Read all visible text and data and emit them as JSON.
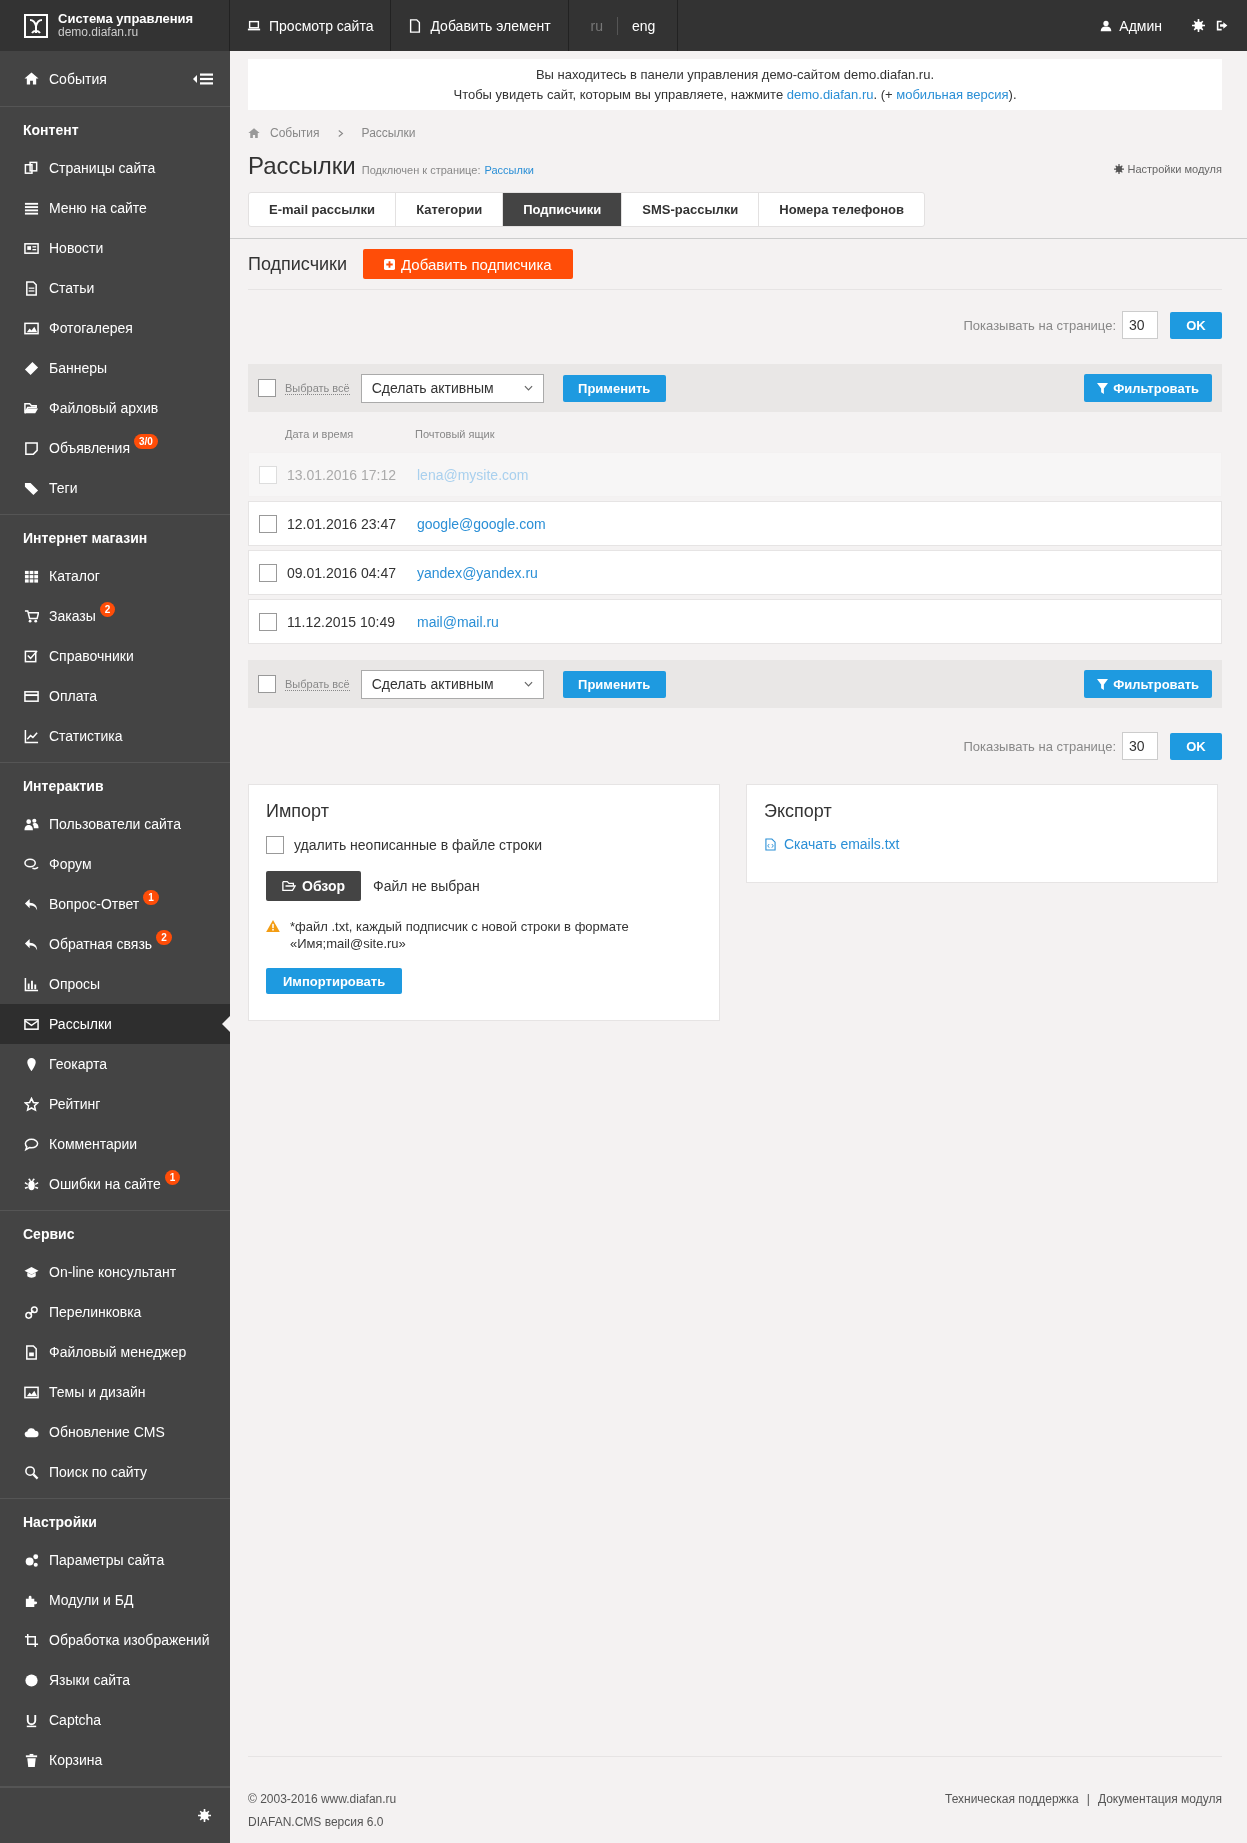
{
  "header": {
    "logo_title": "Система управления",
    "logo_subtitle": "demo.diafan.ru",
    "nav": [
      {
        "label": "Просмотр сайта"
      },
      {
        "label": "Добавить элемент"
      }
    ],
    "languages": [
      {
        "label": "ru",
        "selected": false
      },
      {
        "label": "eng",
        "selected": true
      }
    ],
    "user": "Админ"
  },
  "sidebar": {
    "top_item": "События",
    "sections": [
      {
        "title": "Контент",
        "items": [
          {
            "label": "Страницы сайта",
            "selected": false
          },
          {
            "label": "Меню на сайте",
            "selected": false
          },
          {
            "label": "Новости",
            "selected": false
          },
          {
            "label": "Статьи",
            "selected": false
          },
          {
            "label": "Фотогалерея",
            "selected": false
          },
          {
            "label": "Баннеры",
            "selected": false
          },
          {
            "label": "Файловый архив",
            "selected": false
          },
          {
            "label": "Объявления",
            "badge": "3/0",
            "selected": false
          },
          {
            "label": "Теги",
            "selected": false
          }
        ]
      },
      {
        "title": "Интернет магазин",
        "items": [
          {
            "label": "Каталог",
            "selected": false
          },
          {
            "label": "Заказы",
            "badge": "2",
            "selected": false
          },
          {
            "label": "Справочники",
            "selected": false
          },
          {
            "label": "Оплата",
            "selected": false
          },
          {
            "label": "Статистика",
            "selected": false
          }
        ]
      },
      {
        "title": "Интерактив",
        "items": [
          {
            "label": "Пользователи сайта",
            "selected": false
          },
          {
            "label": "Форум",
            "selected": false
          },
          {
            "label": "Вопрос-Ответ",
            "badge": "1",
            "selected": false
          },
          {
            "label": "Обратная связь",
            "badge": "2",
            "selected": false
          },
          {
            "label": "Опросы",
            "selected": false
          },
          {
            "label": "Рассылки",
            "selected": true
          },
          {
            "label": "Геокарта",
            "selected": false
          },
          {
            "label": "Рейтинг",
            "selected": false
          },
          {
            "label": "Комментарии",
            "selected": false
          },
          {
            "label": "Ошибки на сайте",
            "badge": "1",
            "selected": false
          }
        ]
      },
      {
        "title": "Сервис",
        "items": [
          {
            "label": "On-line консультант",
            "selected": false
          },
          {
            "label": "Перелинковка",
            "selected": false
          },
          {
            "label": "Файловый менеджер",
            "selected": false
          },
          {
            "label": "Темы и дизайн",
            "selected": false
          },
          {
            "label": "Обновление CMS",
            "selected": false
          },
          {
            "label": "Поиск по сайту",
            "selected": false
          }
        ]
      },
      {
        "title": "Настройки",
        "items": [
          {
            "label": "Параметры сайта",
            "selected": false
          },
          {
            "label": "Модули и БД",
            "selected": false
          },
          {
            "label": "Обработка изображений",
            "selected": false
          },
          {
            "label": "Языки сайта",
            "selected": false
          },
          {
            "label": "Captcha",
            "selected": false
          },
          {
            "label": "Корзина",
            "selected": false
          }
        ]
      }
    ]
  },
  "notice": {
    "line1": "Вы находитесь в панели управления демо-сайтом demo.diafan.ru.",
    "line2_start": "Чтобы увидеть сайт, которым вы управляете, нажмите ",
    "site_link": "demo.diafan.ru",
    "line2_middle": ". (+ ",
    "mobile_link": "мобильная версия",
    "line2_end": ")."
  },
  "breadcrumbs": [
    "События",
    "Рассылки"
  ],
  "page_title": "Рассылки",
  "connected_label": "Подключен к странице:",
  "connected_link": "Рассылки",
  "settings_link": "Настройки модуля",
  "tabs": [
    {
      "label": "E-mail рассылки",
      "selected": false
    },
    {
      "label": "Категории",
      "selected": false
    },
    {
      "label": "Подписчики",
      "selected": true
    },
    {
      "label": "SMS-рассылки",
      "selected": false
    },
    {
      "label": "Номера телефонов",
      "selected": false
    }
  ],
  "section_title": "Подписчики",
  "add_button": "Добавить подписчика",
  "per_page": [
    {
      "label": "Показывать на странице:",
      "value": "30",
      "button": "OK"
    },
    {
      "label": "Показывать на странице:",
      "value": "30",
      "button": "OK"
    }
  ],
  "toolbars": [
    {
      "select_all": "Выбрать всё",
      "checked": false,
      "action": "Сделать активным",
      "apply": "Применить",
      "filter": "Фильтровать"
    },
    {
      "select_all": "Выбрать всё",
      "checked": false,
      "action": "Сделать активным",
      "apply": "Применить",
      "filter": "Фильтровать"
    }
  ],
  "table": {
    "columns": [
      "Дата и время",
      "Почтовый ящик"
    ],
    "rows": [
      {
        "date": "13.01.2016 17:12",
        "email": "lena@mysite.com",
        "active": false,
        "checked": false
      },
      {
        "date": "12.01.2016 23:47",
        "email": "google@google.com",
        "active": true,
        "checked": false
      },
      {
        "date": "09.01.2016 04:47",
        "email": "yandex@yandex.ru",
        "active": true,
        "checked": false
      },
      {
        "date": "11.12.2015 10:49",
        "email": "mail@mail.ru",
        "active": true,
        "checked": false
      }
    ]
  },
  "import": {
    "title": "Импорт",
    "checkbox_label": "удалить неописанные в файле строки",
    "checked": false,
    "browse_button": "Обзор",
    "file_status": "Файл не выбран",
    "hint": "*файл .txt, каждый подписчик с новой строки в формате «Имя;mail@site.ru»",
    "import_button": "Импортировать"
  },
  "export": {
    "title": "Экспорт",
    "link": "Скачать emails.txt"
  },
  "footer": {
    "copyright": "© 2003-2016 www.diafan.ru",
    "version": "DIAFAN.CMS версия 6.0",
    "links": [
      "Техническая поддержка",
      "Документация модуля"
    ],
    "link_separator": "|"
  }
}
